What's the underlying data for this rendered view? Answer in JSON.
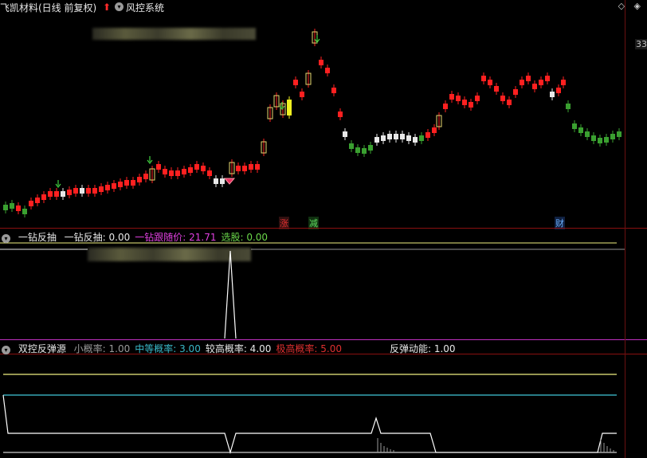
{
  "header": {
    "title": "飞凯材料(日线 前复权)",
    "system_label": "风控系统",
    "window_buttons": "◇ ◈"
  },
  "price_axis": {
    "label": "33"
  },
  "markers": {
    "zhang": "涨",
    "jian": "减",
    "cai": "财"
  },
  "panel1": {
    "name": "一钻反抽",
    "items": [
      {
        "label": "一钻反抽: 0.00",
        "color": "#e8e8e8"
      },
      {
        "label": "一钻跟随价: 21.71",
        "color": "#e040e0"
      },
      {
        "label": "选股: 0.00",
        "color": "#6ad84a"
      }
    ]
  },
  "panel2": {
    "name": "双控反弹源",
    "items": [
      {
        "label": "小概率: 1.00",
        "color": "#9a9a9a"
      },
      {
        "label": "中等概率: 3.00",
        "color": "#3ab8c8"
      },
      {
        "label": "较高概率: 4.00",
        "color": "#e8e8e8"
      },
      {
        "label": "极高概率: 5.00",
        "color": "#e03030"
      },
      {
        "label": "反弹动能: 1.00",
        "color": "#e8e8e8"
      }
    ]
  },
  "colors": {
    "up": "#ff2020",
    "down": "#3aa030",
    "highlight": "#e8d870",
    "yellow_line": "#f0f080",
    "cyan_line": "#40c8d8"
  }
}
